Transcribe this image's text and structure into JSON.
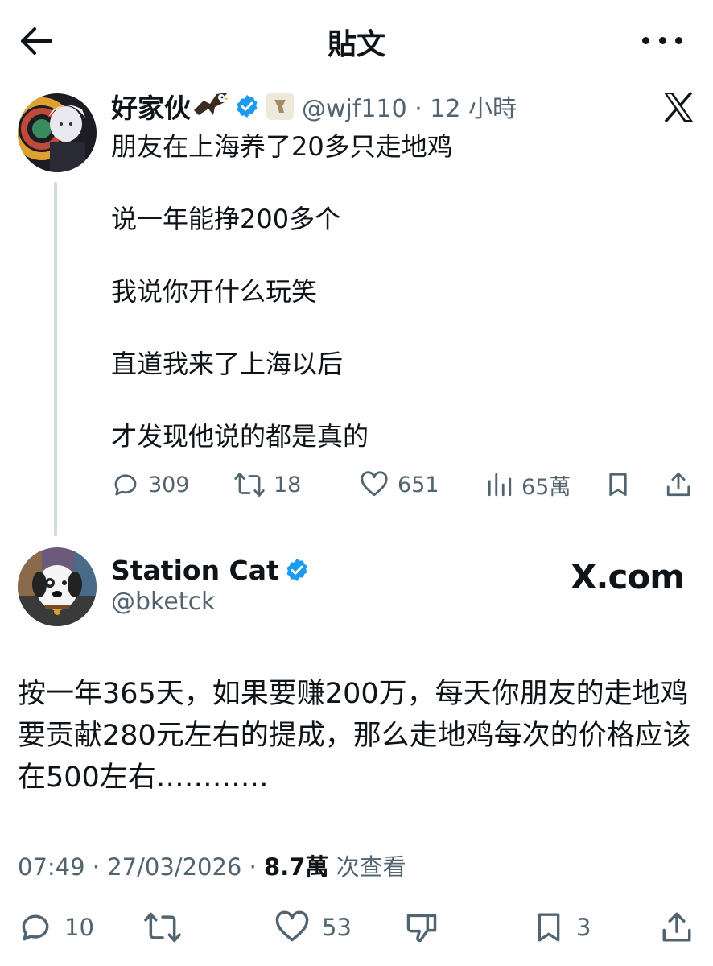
{
  "header": {
    "title": "貼文"
  },
  "quoted_tweet": {
    "name": "好家伙",
    "handle_time": "@wjf110 · 12 小時",
    "lines": [
      "朋友在上海养了20多只走地鸡",
      "说一年能挣200多个",
      "我说你开什么玩笑",
      "直道我来了上海以后",
      "才发现他说的都是真的"
    ],
    "stats": {
      "replies": "309",
      "reposts": "18",
      "likes": "651",
      "views": "65萬"
    }
  },
  "main_tweet": {
    "name": "Station Cat",
    "handle": "@bketck",
    "badge_text": "X.com",
    "body": "按一年365天，如果要赚200万，每天你朋友的走地鸡要贡献280元左右的提成，那么走地鸡每次的价格应该在500左右…………",
    "meta": {
      "time": "07:49 · 27/03/2026 · ",
      "views": "8.7萬",
      "views_label": " 次查看"
    },
    "stats": {
      "replies": "10",
      "likes": "53",
      "bookmarks": "3"
    }
  },
  "colors": {
    "verified": "#1d9bf0",
    "secondary_text": "#536471",
    "primary_text": "#0f1419",
    "thread_line": "#cfd9de"
  }
}
